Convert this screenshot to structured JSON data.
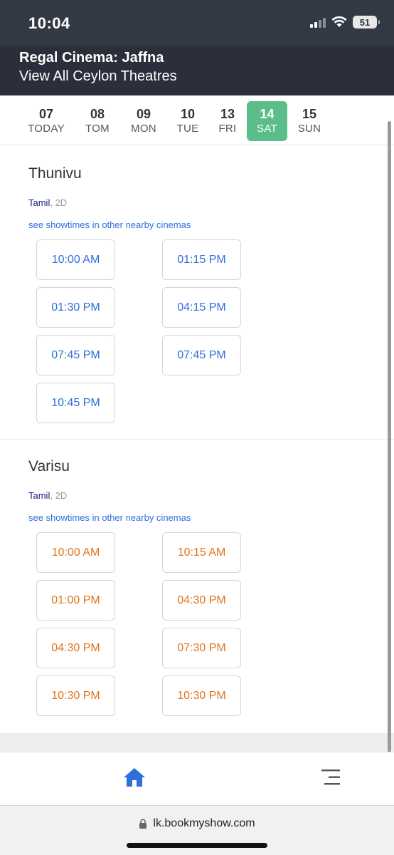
{
  "status_bar": {
    "time": "10:04",
    "battery": "51"
  },
  "theatre": {
    "name": "Regal Cinema: Jaffna",
    "view_all": "View All Ceylon Theatres"
  },
  "dates": [
    {
      "day": "07",
      "label": "TODAY"
    },
    {
      "day": "08",
      "label": "TOM"
    },
    {
      "day": "09",
      "label": "MON"
    },
    {
      "day": "10",
      "label": "TUE"
    },
    {
      "day": "13",
      "label": "FRI"
    },
    {
      "day": "14",
      "label": "SAT",
      "selected": true
    },
    {
      "day": "15",
      "label": "SUN"
    }
  ],
  "movies": [
    {
      "title": "Thunivu",
      "language": "Tamil",
      "format": ", 2D",
      "nearby_link": "see showtimes in other nearby cinemas",
      "status_color": "#2f6fdb",
      "showtimes": [
        "10:00 AM",
        "01:15 PM",
        "01:30 PM",
        "04:15 PM",
        "07:45 PM",
        "07:45 PM",
        "10:45 PM"
      ]
    },
    {
      "title": "Varisu",
      "language": "Tamil",
      "format": ", 2D",
      "nearby_link": "see showtimes in other nearby cinemas",
      "status_color": "#e0741c",
      "showtimes": [
        "10:00 AM",
        "10:15 AM",
        "01:00 PM",
        "04:30 PM",
        "04:30 PM",
        "07:30 PM",
        "10:30 PM",
        "10:30 PM"
      ]
    }
  ],
  "bottom_nav": {
    "home_icon": "home-icon",
    "menu_icon": "menu-icon"
  },
  "url_bar": {
    "url": "lk.bookmyshow.com",
    "lock_icon": "lock-icon"
  },
  "colors": {
    "selected_date": "#5bbe8a",
    "header_bg": "#2b2e3b",
    "link": "#2f6fdb"
  }
}
